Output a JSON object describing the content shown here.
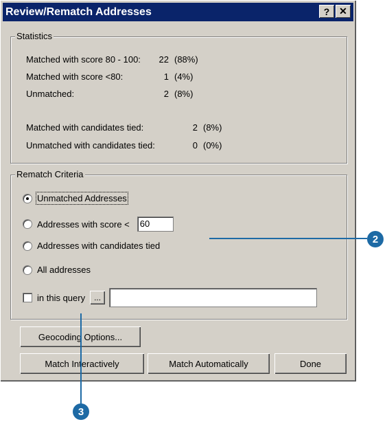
{
  "window": {
    "title": "Review/Rematch Addresses",
    "help_label": "?",
    "close_label": "✕"
  },
  "statistics": {
    "legend": "Statistics",
    "rows": [
      {
        "label": "Matched with score 80 - 100:",
        "count": "22",
        "pct": "(88%)"
      },
      {
        "label": "Matched with score <80:",
        "count": "1",
        "pct": "(4%)"
      },
      {
        "label": "Unmatched:",
        "count": "2",
        "pct": "(8%)"
      },
      {
        "label": "Matched with candidates tied:",
        "count": "2",
        "pct": "(8%)"
      },
      {
        "label": "Unmatched with candidates tied:",
        "count": "0",
        "pct": "(0%)"
      }
    ]
  },
  "rematch": {
    "legend": "Rematch Criteria",
    "options": [
      {
        "label": "Unmatched Addresses",
        "selected": true
      },
      {
        "label": "Addresses with score <",
        "selected": false
      },
      {
        "label": "Addresses with candidates tied",
        "selected": false
      },
      {
        "label": "All addresses",
        "selected": false
      }
    ],
    "score_value": "60",
    "query_label": "in this query",
    "query_browse_label": "...",
    "query_value": ""
  },
  "buttons": {
    "geocoding_options": "Geocoding Options...",
    "match_interactively": "Match Interactively",
    "match_automatically": "Match Automatically",
    "done": "Done"
  },
  "callouts": {
    "step2": "2",
    "step3": "3"
  },
  "colors": {
    "titlebar": "#0a246a",
    "dialog": "#d4d0c8",
    "callout": "#1d6aa5"
  }
}
